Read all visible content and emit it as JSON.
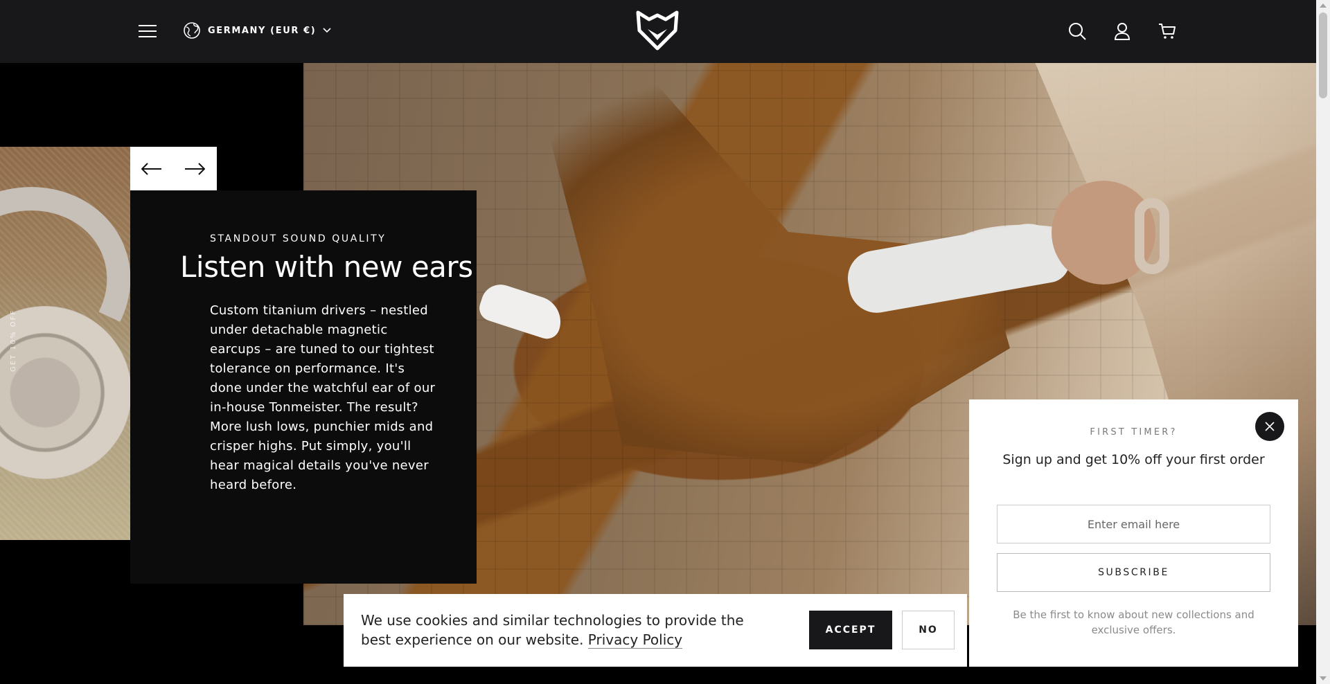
{
  "header": {
    "country_label": "GERMANY (EUR €)",
    "icons": {
      "menu": "hamburger-menu-icon",
      "globe": "globe-icon",
      "chevron": "chevron-down-icon",
      "logo": "fox-logo",
      "search": "search-icon",
      "account": "account-icon",
      "cart": "cart-icon"
    }
  },
  "slider": {
    "side_label": "GET 10% OFF",
    "prev_icon": "arrow-left-icon",
    "next_icon": "arrow-right-icon"
  },
  "hero": {
    "eyebrow": "STANDOUT SOUND QUALITY",
    "headline": "Listen with new ears",
    "body": "Custom titanium drivers – nestled under detachable magnetic earcups – are tuned to our tightest tolerance on performance. It's done under the watchful ear of our in-house Tonmeister. The result? More lush lows, punchier mids and crisper highs. Put simply, you'll hear magical details you've never heard before."
  },
  "cookie_banner": {
    "text": "We use cookies and similar technologies to provide the best experience on our website.",
    "link": "Privacy Policy",
    "accept_label": "ACCEPT",
    "decline_label": "NO"
  },
  "signup_popup": {
    "eyebrow": "FIRST TIMER?",
    "title": "Sign up and get 10% off your first order",
    "email_placeholder": "Enter email here",
    "subscribe_label": "SUBSCRIBE",
    "footnote": "Be the first to know about new collections and exclusive offers.",
    "close_icon": "close-icon"
  },
  "colors": {
    "header_bg": "#18181b",
    "panel_bg": "#0c0c0c",
    "accent_dark": "#18181b"
  }
}
